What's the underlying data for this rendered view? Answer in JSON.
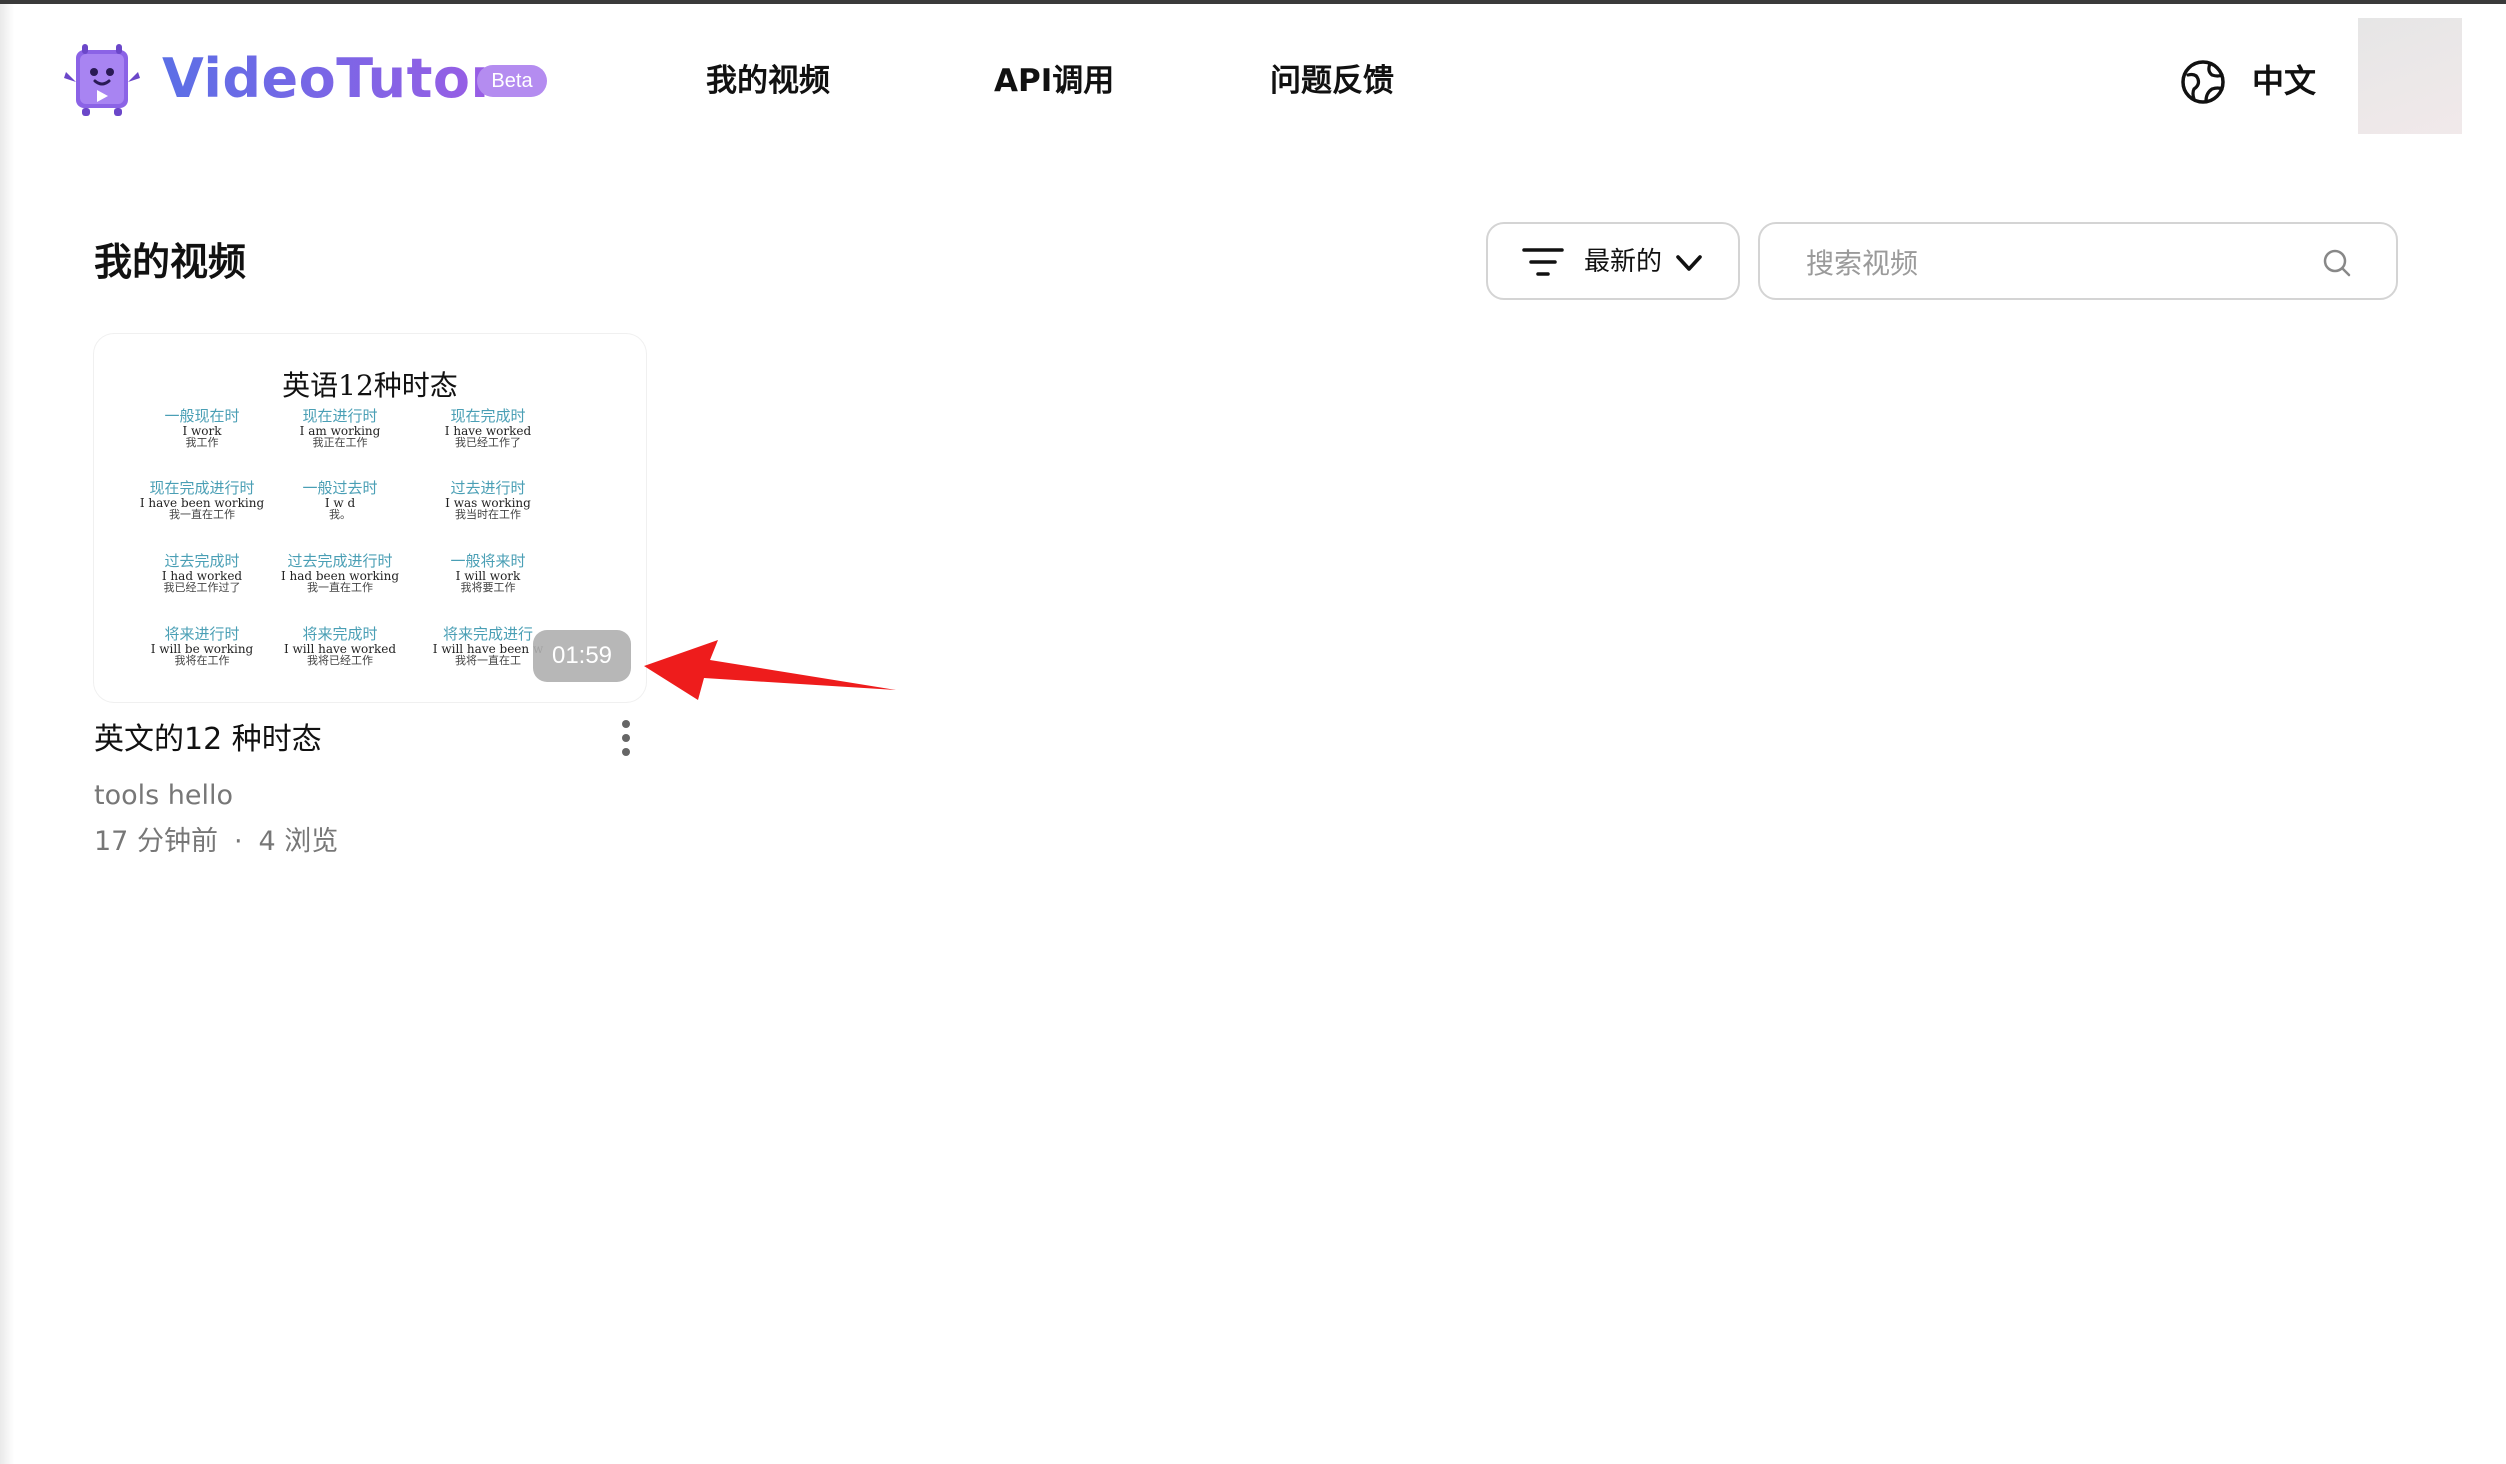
{
  "header": {
    "brand_name": "VideoTutor",
    "badge": "Beta",
    "nav": [
      {
        "label": "我的视频"
      },
      {
        "label": "API调用"
      },
      {
        "label": "问题反馈"
      }
    ],
    "language": "中文",
    "icons": {
      "logo": "robot-book-logo",
      "language": "globe-icon"
    }
  },
  "main": {
    "title": "我的视频",
    "sort": {
      "label": "最新的"
    },
    "search": {
      "placeholder": "搜索视频",
      "value": ""
    }
  },
  "videos": [
    {
      "title": "英文的12 种时态",
      "author": "tools hello",
      "time_ago": "17 分钟前",
      "views": "4 浏览",
      "duration": "01:59",
      "thumbnail": {
        "heading": "英语12种时态",
        "tenses": [
          {
            "cn": "一般现在时",
            "en": "I work",
            "zh": "我工作"
          },
          {
            "cn": "现在进行时",
            "en": "I am working",
            "zh": "我正在工作"
          },
          {
            "cn": "现在完成时",
            "en": "I have worked",
            "zh": "我已经工作了"
          },
          {
            "cn": "现在完成进行时",
            "en": "I have been working",
            "zh": "我一直在工作"
          },
          {
            "cn": "一般过去时",
            "en": "I w   d",
            "zh": "我。"
          },
          {
            "cn": "过去进行时",
            "en": "I was working",
            "zh": "我当时在工作"
          },
          {
            "cn": "过去完成时",
            "en": "I had worked",
            "zh": "我已经工作过了"
          },
          {
            "cn": "过去完成进行时",
            "en": "I had been working",
            "zh": "我一直在工作"
          },
          {
            "cn": "一般将来时",
            "en": "I will work",
            "zh": "我将要工作"
          },
          {
            "cn": "将来进行时",
            "en": "I will be working",
            "zh": "我将在工作"
          },
          {
            "cn": "将来完成时",
            "en": "I will have worked",
            "zh": "我将已经工作"
          },
          {
            "cn": "将来完成进行",
            "en": "I will have been w",
            "zh": "我将一直在工"
          }
        ]
      }
    }
  ],
  "colors": {
    "brand_gradient_start": "#5b6fe6",
    "brand_gradient_end": "#9b5de5",
    "badge": "#b48cf0",
    "tense_label": "#4a9fb5",
    "annotation_arrow": "#ee1c1c"
  }
}
